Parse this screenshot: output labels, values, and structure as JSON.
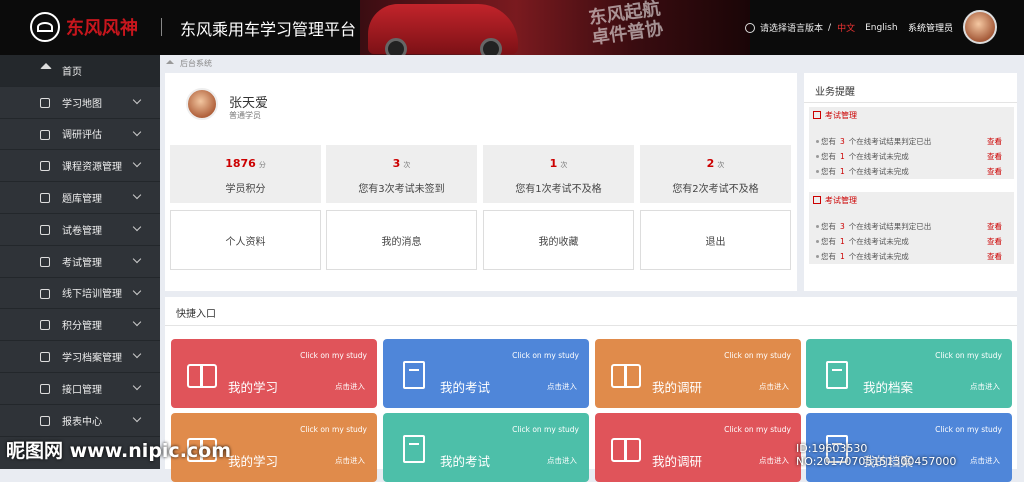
{
  "header": {
    "brand": "东风风神",
    "platform_title": "东风乘用车学习管理平台",
    "slogan_1": "东风起航",
    "slogan_2": "卓件普协",
    "lang_prompt": "请选择语言版本",
    "lang_sep": "/",
    "lang_cn": "中文",
    "lang_en": "English",
    "user_role": "系统管理员"
  },
  "sidebar": {
    "items": [
      {
        "label": "首页",
        "icon": "home-icon"
      },
      {
        "label": "学习地图",
        "icon": "map-icon"
      },
      {
        "label": "调研评估",
        "icon": "survey-icon"
      },
      {
        "label": "课程资源管理",
        "icon": "book-icon"
      },
      {
        "label": "题库管理",
        "icon": "question-bank-icon"
      },
      {
        "label": "试卷管理",
        "icon": "paper-icon"
      },
      {
        "label": "考试管理",
        "icon": "exam-icon"
      },
      {
        "label": "线下培训管理",
        "icon": "training-icon"
      },
      {
        "label": "积分管理",
        "icon": "points-icon"
      },
      {
        "label": "学习档案管理",
        "icon": "archive-icon"
      },
      {
        "label": "接口管理",
        "icon": "interface-icon"
      },
      {
        "label": "报表中心",
        "icon": "report-icon"
      }
    ]
  },
  "breadcrumb": "后台系统",
  "profile": {
    "name": "张天爱",
    "role": "普通学员",
    "stats": [
      {
        "value": "1876",
        "unit": "分",
        "label": "学员积分"
      },
      {
        "value": "3",
        "unit": "次",
        "label": "您有3次考试未签到"
      },
      {
        "value": "1",
        "unit": "次",
        "label": "您有1次考试不及格"
      },
      {
        "value": "2",
        "unit": "次",
        "label": "您有2次考试不及格"
      }
    ],
    "actions": [
      "个人资料",
      "我的消息",
      "我的收藏",
      "退出"
    ]
  },
  "alerts": {
    "title": "业务提醒",
    "groups": [
      {
        "title": "考试管理",
        "items": [
          {
            "prefix": "您有",
            "count": "3",
            "text": "个在线考试结果判定已出",
            "link": "查看"
          },
          {
            "prefix": "您有",
            "count": "1",
            "text": "个在线考试未完成",
            "link": "查看"
          },
          {
            "prefix": "您有",
            "count": "1",
            "text": "个在线考试未完成",
            "link": "查看"
          }
        ]
      },
      {
        "title": "考试管理",
        "items": [
          {
            "prefix": "您有",
            "count": "3",
            "text": "个在线考试结果判定已出",
            "link": "查看"
          },
          {
            "prefix": "您有",
            "count": "1",
            "text": "个在线考试未完成",
            "link": "查看"
          },
          {
            "prefix": "您有",
            "count": "1",
            "text": "个在线考试未完成",
            "link": "查看"
          }
        ]
      }
    ]
  },
  "quick": {
    "title": "快捷入口",
    "cards": [
      {
        "name": "我的学习",
        "hint": "Click on my study",
        "enter": "点击进入",
        "color": "#e0545a",
        "icon": "book-icon"
      },
      {
        "name": "我的考试",
        "hint": "Click on my study",
        "enter": "点击进入",
        "color": "#4f86d9",
        "icon": "exam-doc-icon"
      },
      {
        "name": "我的调研",
        "hint": "Click on my study",
        "enter": "点击进入",
        "color": "#e08b4b",
        "icon": "book-icon"
      },
      {
        "name": "我的档案",
        "hint": "Click on my study",
        "enter": "点击进入",
        "color": "#4dbfa9",
        "icon": "archive-doc-icon"
      },
      {
        "name": "我的学习",
        "hint": "Click on my study",
        "enter": "点击进入",
        "color": "#e08b4b",
        "icon": "book-icon"
      },
      {
        "name": "我的考试",
        "hint": "Click on my study",
        "enter": "点击进入",
        "color": "#4dbfa9",
        "icon": "exam-doc-icon"
      },
      {
        "name": "我的调研",
        "hint": "Click on my study",
        "enter": "点击进入",
        "color": "#e0545a",
        "icon": "book-icon"
      },
      {
        "name": "我的档案",
        "hint": "Click on my study",
        "enter": "点击进入",
        "color": "#4f86d9",
        "icon": "archive-doc-icon"
      }
    ]
  },
  "watermark": {
    "left": "昵图网 www.nipic.com",
    "right": "ID:19603530 NO:20170705151300457000"
  }
}
